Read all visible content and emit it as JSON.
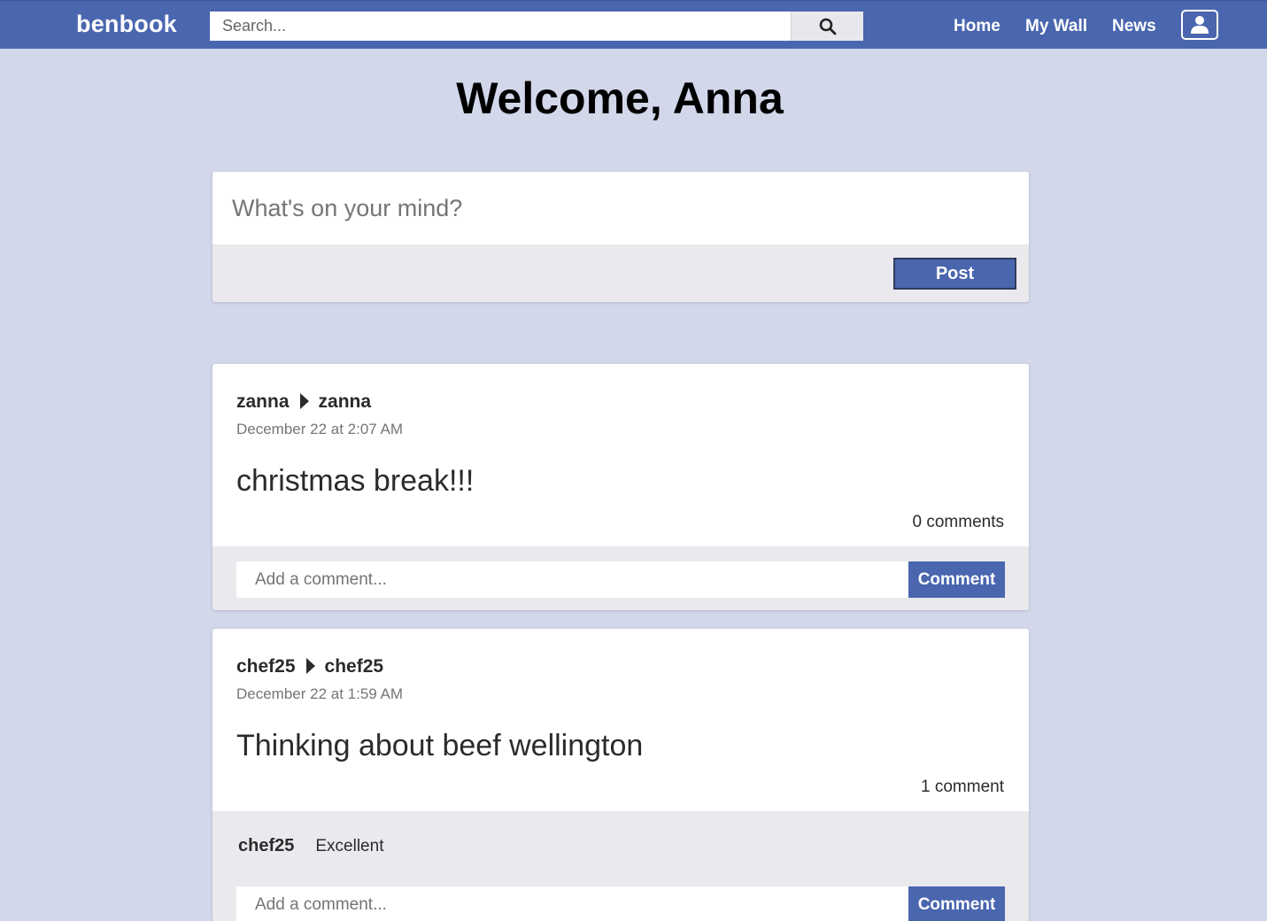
{
  "header": {
    "logo": "benbook",
    "search_placeholder": "Search...",
    "nav": {
      "home": "Home",
      "wall": "My Wall",
      "news": "News"
    }
  },
  "welcome": "Welcome, Anna",
  "composer": {
    "placeholder": "What's on your mind?",
    "post_label": "Post"
  },
  "posts": [
    {
      "author": "zanna",
      "recipient": "zanna",
      "time": "December 22 at 2:07 AM",
      "body": "christmas break!!!",
      "comment_count": "0 comments",
      "comment_placeholder": "Add a comment...",
      "comment_label": "Comment",
      "comments": []
    },
    {
      "author": "chef25",
      "recipient": "chef25",
      "time": "December 22 at 1:59 AM",
      "body": "Thinking about beef wellington",
      "comment_count": "1 comment",
      "comment_placeholder": "Add a comment...",
      "comment_label": "Comment",
      "comments": [
        {
          "author": "chef25",
          "text": "Excellent"
        }
      ]
    }
  ],
  "colors": {
    "brand": "#4a66af",
    "page_background": "#d2d7ea",
    "card_footer": "#e9e9ee"
  }
}
